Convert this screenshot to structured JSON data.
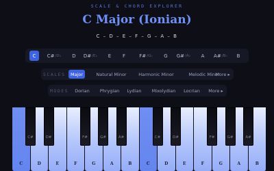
{
  "app": {
    "title": "SCALE & CHORD EXPLORER"
  },
  "scale": {
    "title": "C Major (Ionian)",
    "notes_display": "C – D – E – F – G – A – B"
  },
  "roots": [
    {
      "label": "C",
      "alt": "",
      "active": true
    },
    {
      "label": "C#",
      "alt": "/D♭",
      "active": false
    },
    {
      "label": "D",
      "alt": "",
      "active": false
    },
    {
      "label": "D#",
      "alt": "/E♭",
      "active": false
    },
    {
      "label": "E",
      "alt": "",
      "active": false
    },
    {
      "label": "F",
      "alt": "",
      "active": false
    },
    {
      "label": "F#",
      "alt": "/G♭",
      "active": false
    },
    {
      "label": "G",
      "alt": "",
      "active": false
    },
    {
      "label": "G#",
      "alt": "/A♭",
      "active": false
    },
    {
      "label": "A",
      "alt": "",
      "active": false
    },
    {
      "label": "A#",
      "alt": "/B♭",
      "active": false
    },
    {
      "label": "B",
      "alt": "",
      "active": false
    }
  ],
  "scales": {
    "label": "SCALES",
    "items": [
      "Major",
      "Natural Minor",
      "Harmonic Minor",
      "Melodic Minor"
    ],
    "active_index": 0,
    "more_label": "More ▸"
  },
  "modes": {
    "label": "MODES",
    "items": [
      "Dorian",
      "Phrygian",
      "Lydian",
      "Mixolydian",
      "Locrian"
    ],
    "more_label": "More ▸"
  },
  "keyboard": {
    "white_keys": [
      {
        "note": "C",
        "state": "root",
        "label": "C"
      },
      {
        "note": "D",
        "state": "in",
        "label": "D"
      },
      {
        "note": "E",
        "state": "in",
        "label": "E"
      },
      {
        "note": "F",
        "state": "in",
        "label": "F"
      },
      {
        "note": "G",
        "state": "in",
        "label": "G"
      },
      {
        "note": "A",
        "state": "in",
        "label": "A"
      },
      {
        "note": "B",
        "state": "in",
        "label": "B"
      },
      {
        "note": "C",
        "state": "root",
        "label": "C"
      },
      {
        "note": "D",
        "state": "in",
        "label": "D"
      },
      {
        "note": "E",
        "state": "in",
        "label": "E"
      },
      {
        "note": "F",
        "state": "in",
        "label": "F"
      },
      {
        "note": "G",
        "state": "in",
        "label": "G"
      },
      {
        "note": "A",
        "state": "in",
        "label": "A"
      },
      {
        "note": "B",
        "state": "in",
        "label": "B"
      }
    ],
    "black_keys": [
      {
        "note": "C#",
        "label": "C#"
      },
      {
        "note": "D#",
        "label": "D#"
      },
      {
        "note": "F#",
        "label": "F#"
      },
      {
        "note": "G#",
        "label": "G#"
      },
      {
        "note": "A#",
        "label": "A#"
      },
      {
        "note": "C#",
        "label": "C#"
      },
      {
        "note": "D#",
        "label": "D#"
      },
      {
        "note": "F#",
        "label": "F#"
      },
      {
        "note": "G#",
        "label": "G#"
      },
      {
        "note": "A#",
        "label": "A#"
      }
    ]
  },
  "colors": {
    "accent": "#3f63e0",
    "title": "#6f8ff5",
    "background": "#0d0e16",
    "panel": "#161825"
  }
}
